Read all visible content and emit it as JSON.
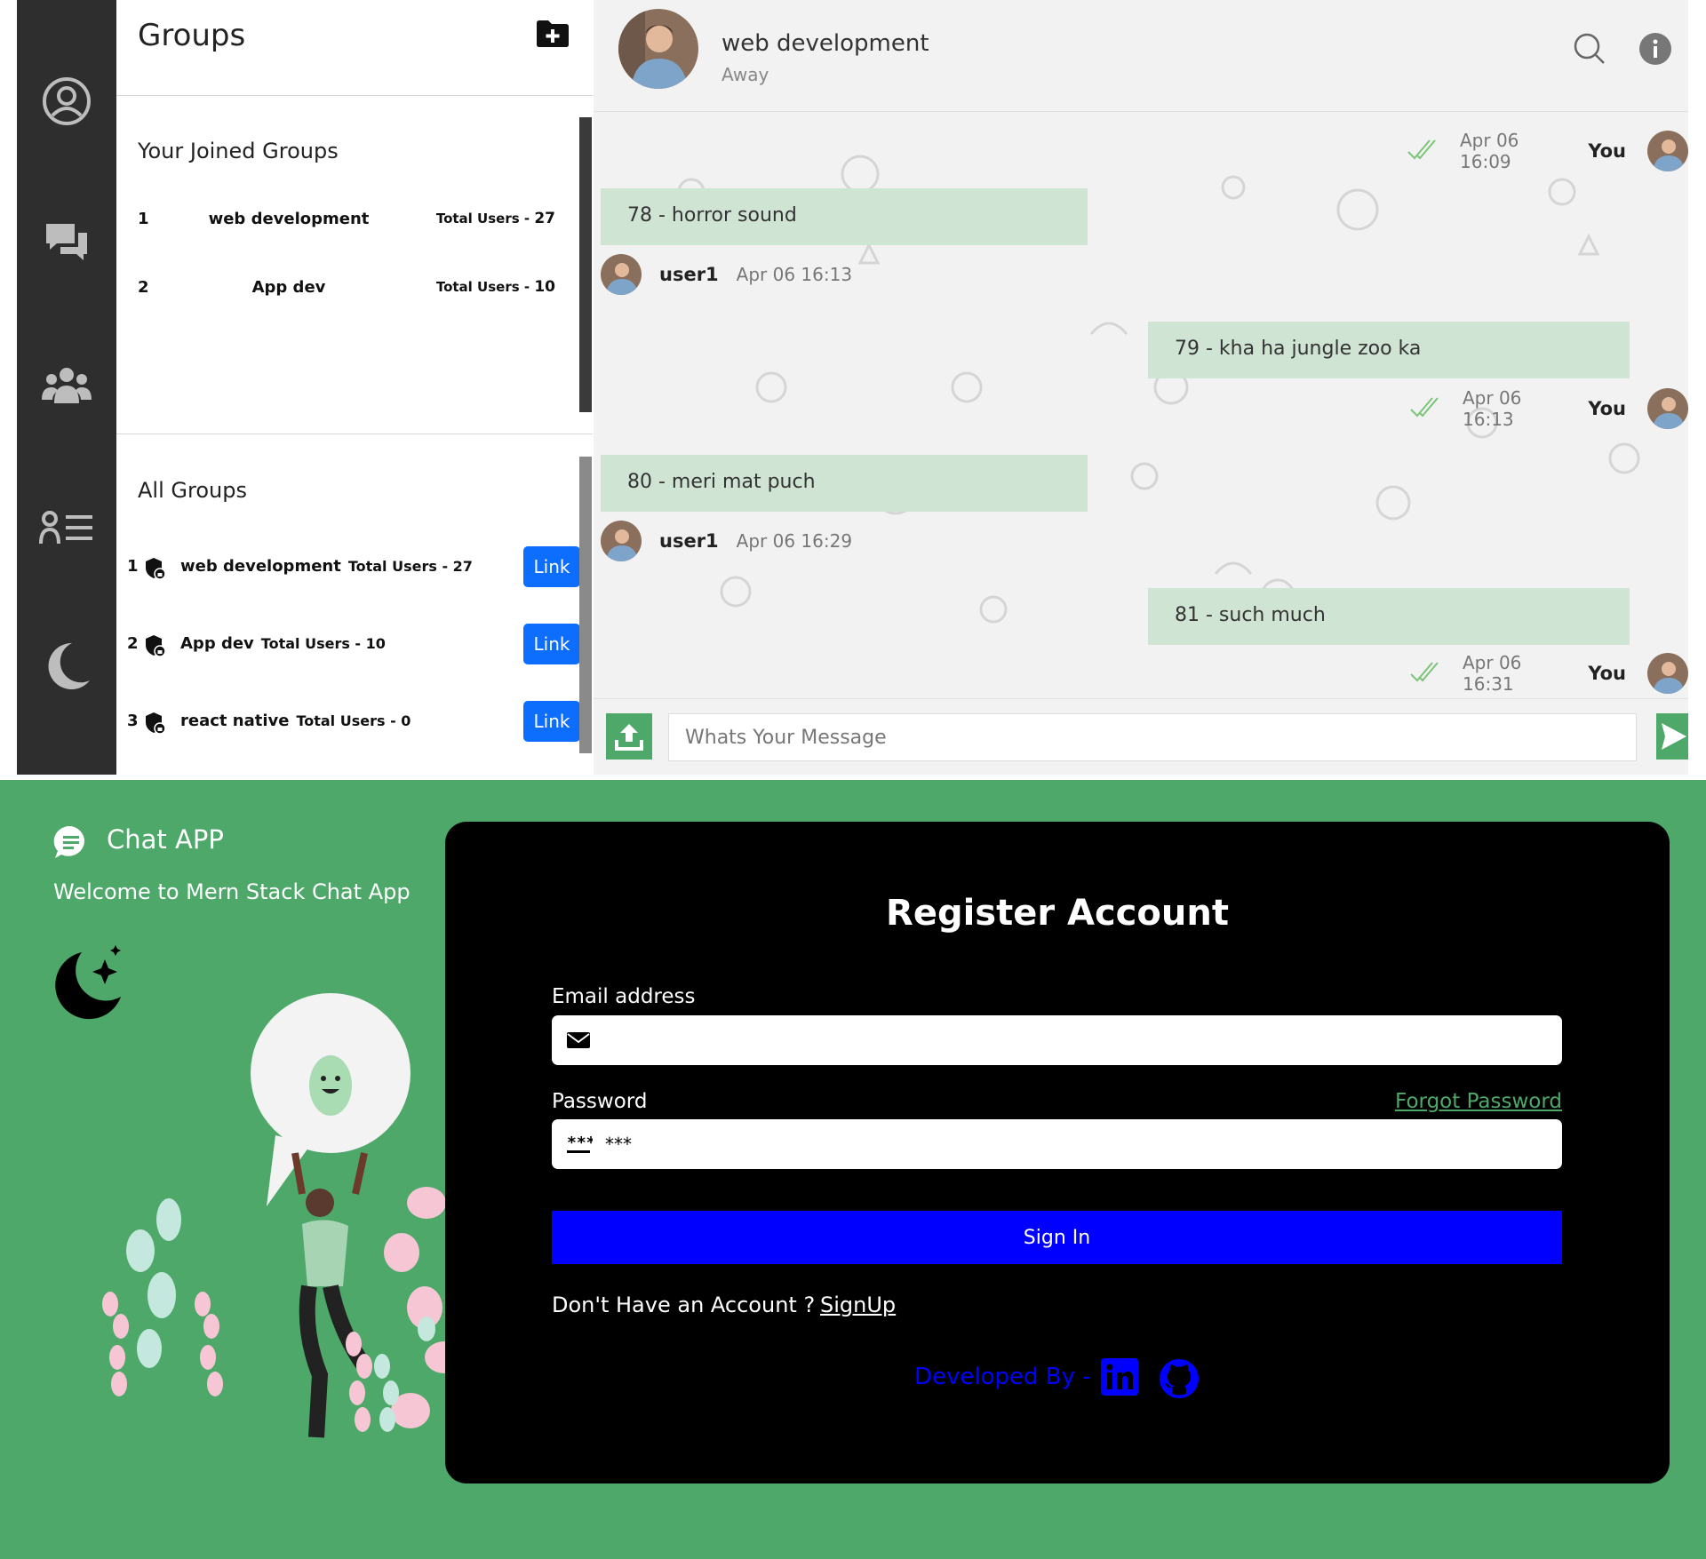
{
  "groups": {
    "title": "Groups",
    "joined_title": "Your Joined Groups",
    "joined": [
      {
        "num": "1",
        "name": "web development",
        "total_label": "Total Users - ",
        "total": "27"
      },
      {
        "num": "2",
        "name": "App dev",
        "total_label": "Total Users - ",
        "total": "10"
      }
    ],
    "all_title": "All Groups",
    "all": [
      {
        "num": "1",
        "name": "web development",
        "total_label": "Total Users - ",
        "total": "27",
        "button": "Link"
      },
      {
        "num": "2",
        "name": "App dev",
        "total_label": "Total Users - ",
        "total": "10",
        "button": "Link"
      },
      {
        "num": "3",
        "name": "react native",
        "total_label": "Total Users - ",
        "total": "0",
        "button": "Link"
      }
    ]
  },
  "chat": {
    "name": "web development",
    "status": "Away",
    "messages": [
      {
        "sender": "You",
        "time": "Apr 06 16:09",
        "text": ""
      },
      {
        "sender": "user1",
        "time": "Apr 06 16:13",
        "text": "78 - horror sound"
      },
      {
        "sender": "You",
        "time": "Apr 06 16:13",
        "text": "79 - kha ha jungle zoo ka"
      },
      {
        "sender": "user1",
        "time": "Apr 06 16:29",
        "text": "80 - meri mat puch"
      },
      {
        "sender": "You",
        "time": "Apr 06 16:31",
        "text": "81 - such much"
      }
    ],
    "input_placeholder": "Whats Your Message"
  },
  "register": {
    "app_name": "Chat APP",
    "welcome": "Welcome to Mern Stack Chat App",
    "title": "Register Account",
    "email_label": "Email address",
    "email_value": "",
    "password_label": "Password",
    "password_value": "***",
    "forgot": "Forgot Password",
    "signin": "Sign In",
    "no_account": "Don't Have an Account ?",
    "signup": "SignUp",
    "developed_by": "Developed By -"
  },
  "colors": {
    "brand_green": "#4ea86a",
    "bubble_green": "#cfe4d3",
    "link_blue": "#0d6efd",
    "signin_blue": "#0000ff",
    "rail_dark": "#2e2e2e"
  },
  "icons": [
    "user-circle-icon",
    "chat-icon",
    "people-icon",
    "contacts-list-icon",
    "moon-icon",
    "add-folder-icon",
    "search-icon",
    "info-icon",
    "double-check-icon",
    "upload-icon",
    "send-icon",
    "chat-bubble-logo-icon",
    "moon-stars-icon",
    "envelope-icon",
    "password-dots-icon",
    "linkedin-icon",
    "github-icon",
    "shield-icon"
  ]
}
